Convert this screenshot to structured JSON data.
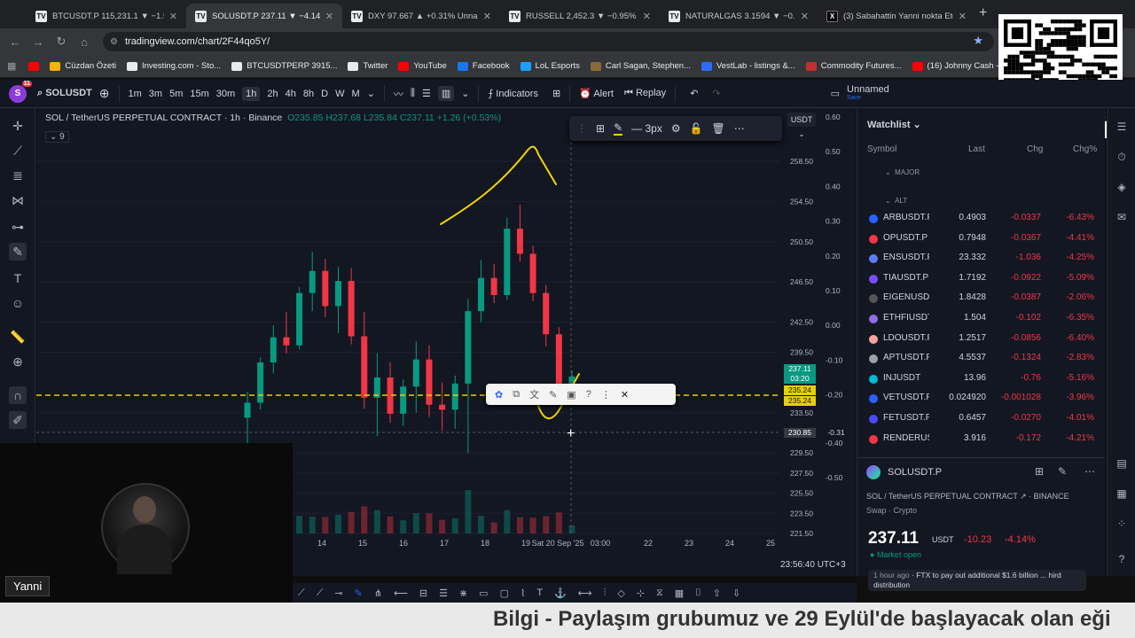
{
  "browser": {
    "tabs": [
      {
        "label": "BTCUSDT.P 115,231.1 ▼ −1.53%",
        "icon": "tradingview-icon",
        "active": false
      },
      {
        "label": "SOLUSDT.P 237.11 ▼ −4.14% U",
        "icon": "tradingview-icon",
        "active": true
      },
      {
        "label": "DXY 97.667 ▲ +0.31% Unname",
        "icon": "tradingview-icon",
        "active": false
      },
      {
        "label": "RUSSELL 2,452.3 ▼ −0.95% Un",
        "icon": "tradingview-icon",
        "active": false
      },
      {
        "label": "NATURALGAS 3.1594 ▼ −0.77%",
        "icon": "tradingview-icon",
        "active": false
      },
      {
        "label": "(3) Sabahattin Yanni nokta Etek",
        "icon": "x-icon",
        "active": false
      }
    ],
    "url": "tradingview.com/chart/2F44qo5Y/",
    "bookmarks": [
      {
        "label": "Cüzdan Özeti",
        "color": "#f5b400"
      },
      {
        "label": "Investing.com - Sto...",
        "color": "#e8eaed"
      },
      {
        "label": "BTCUSDTPERP 3915...",
        "color": "#e8eaed"
      },
      {
        "label": "Twitter",
        "color": "#e8eaed"
      },
      {
        "label": "YouTube",
        "color": "#ff0000"
      },
      {
        "label": "Facebook",
        "color": "#1877f2"
      },
      {
        "label": "LoL Esports",
        "color": "#1aa0ff"
      },
      {
        "label": "Carl Sagan, Stephen...",
        "color": "#8a6a3a"
      },
      {
        "label": "VestLab - listings &...",
        "color": "#2d6bff"
      },
      {
        "label": "Commodity Futures...",
        "color": "#c03030"
      },
      {
        "label": "(16) Johnny Cash -...",
        "color": "#ff0000"
      }
    ]
  },
  "toolbar": {
    "avatar_letter": "S",
    "avatar_badge": "11",
    "symbol": "SOLUSDT",
    "intervals": [
      "1m",
      "3m",
      "5m",
      "15m",
      "30m",
      "1h",
      "2h",
      "4h",
      "8h",
      "D",
      "W",
      "M"
    ],
    "active_interval": "1h",
    "indicators_label": "Indicators",
    "alert_label": "Alert",
    "replay_label": "Replay",
    "layout_name": "Unnamed",
    "layout_sub": "Save"
  },
  "legend": {
    "title": "SOL / TetherUS PERPETUAL CONTRACT · 1h · Binance",
    "open": "O235.85",
    "high": "H237.68",
    "low": "L235.84",
    "close": "C237.11",
    "change": "+1.26 (+0.53%)",
    "indicator_count": "9"
  },
  "drawing_toolbar": {
    "width_label": "3px"
  },
  "currency_button": "USDT",
  "chart_data": {
    "type": "candlestick",
    "price_axis": {
      "ticks": [
        "258.50",
        "254.50",
        "250.50",
        "246.50",
        "242.50",
        "239.50",
        "233.50",
        "229.50",
        "227.50",
        "225.50",
        "223.50",
        "221.50"
      ]
    },
    "oscillator_axis": {
      "ticks": [
        "0.60",
        "0.50",
        "0.40",
        "0.30",
        "0.20",
        "0.10",
        "0.00",
        "-0.10",
        "-0.20",
        "-0.40",
        "-0.50"
      ]
    },
    "price_labels": [
      {
        "value": "237.11",
        "sub": "03:20",
        "bg": "#089981"
      },
      {
        "value": "235.24",
        "sub": "",
        "bg": "#e8d000"
      },
      {
        "value": "235.24",
        "sub": "",
        "bg": "#e8d000"
      },
      {
        "value": "230.85",
        "sub": "",
        "bg": "#363a45"
      },
      {
        "value": "-0.31",
        "sub": "",
        "bg": "#131722"
      }
    ],
    "time_axis": [
      "14",
      "15",
      "16",
      "17",
      "18",
      "19",
      "Sat 20 Sep '25",
      "03:00",
      "22",
      "23",
      "24",
      "25"
    ],
    "clock": "23:56:40 UTC+3",
    "candles": [
      {
        "o": 233.0,
        "h": 235.6,
        "l": 229.9,
        "c": 234.5
      },
      {
        "o": 234.5,
        "h": 239.0,
        "l": 233.8,
        "c": 238.5
      },
      {
        "o": 238.5,
        "h": 242.2,
        "l": 237.4,
        "c": 241.0
      },
      {
        "o": 241.0,
        "h": 243.5,
        "l": 239.4,
        "c": 240.2
      },
      {
        "o": 240.2,
        "h": 246.0,
        "l": 239.8,
        "c": 245.4
      },
      {
        "o": 245.4,
        "h": 249.5,
        "l": 243.6,
        "c": 247.6
      },
      {
        "o": 247.6,
        "h": 248.8,
        "l": 243.0,
        "c": 244.1
      },
      {
        "o": 244.1,
        "h": 248.0,
        "l": 241.4,
        "c": 246.6
      },
      {
        "o": 246.6,
        "h": 247.9,
        "l": 240.3,
        "c": 241.1
      },
      {
        "o": 241.1,
        "h": 243.5,
        "l": 233.9,
        "c": 235.0
      },
      {
        "o": 235.0,
        "h": 239.4,
        "l": 231.2,
        "c": 237.0
      },
      {
        "o": 237.0,
        "h": 238.5,
        "l": 232.5,
        "c": 233.4
      },
      {
        "o": 233.4,
        "h": 236.8,
        "l": 232.2,
        "c": 236.1
      },
      {
        "o": 236.1,
        "h": 240.6,
        "l": 233.5,
        "c": 238.8
      },
      {
        "o": 238.8,
        "h": 240.2,
        "l": 233.1,
        "c": 234.3
      },
      {
        "o": 234.3,
        "h": 236.5,
        "l": 231.7,
        "c": 233.8
      },
      {
        "o": 233.8,
        "h": 237.2,
        "l": 231.9,
        "c": 236.4
      },
      {
        "o": 236.4,
        "h": 244.8,
        "l": 229.5,
        "c": 243.6
      },
      {
        "o": 243.6,
        "h": 248.7,
        "l": 242.5,
        "c": 246.9
      },
      {
        "o": 246.9,
        "h": 248.3,
        "l": 244.4,
        "c": 245.2
      },
      {
        "o": 245.2,
        "h": 252.9,
        "l": 244.7,
        "c": 251.8
      },
      {
        "o": 251.8,
        "h": 254.2,
        "l": 248.5,
        "c": 249.3
      },
      {
        "o": 249.3,
        "h": 250.1,
        "l": 244.6,
        "c": 245.4
      },
      {
        "o": 245.4,
        "h": 246.2,
        "l": 240.1,
        "c": 241.3
      },
      {
        "o": 241.3,
        "h": 242.0,
        "l": 234.6,
        "c": 235.9
      },
      {
        "o": 235.9,
        "h": 237.7,
        "l": 234.9,
        "c": 237.1
      }
    ]
  },
  "watchlist": {
    "title": "Watchlist",
    "columns": [
      "Symbol",
      "Last",
      "Chg",
      "Chg%"
    ],
    "sections": [
      "MAJOR",
      "ALT"
    ],
    "rows": [
      {
        "symbol": "ARBUSDT.P",
        "last": "0.4903",
        "chg": "-0.0337",
        "chgp": "-6.43%",
        "color": "#2962ff"
      },
      {
        "symbol": "OPUSDT.P",
        "last": "0.7948",
        "chg": "-0.0367",
        "chgp": "-4.41%",
        "color": "#f23645"
      },
      {
        "symbol": "ENSUSDT.P",
        "last": "23.332",
        "chg": "-1.036",
        "chgp": "-4.25%",
        "color": "#5c7cfa"
      },
      {
        "symbol": "TIAUSDT.P",
        "last": "1.7192",
        "chg": "-0.0922",
        "chgp": "-5.09%",
        "color": "#7c4dff"
      },
      {
        "symbol": "EIGENUSDT.P",
        "last": "1.8428",
        "chg": "-0.0387",
        "chgp": "-2.06%",
        "color": "#555"
      },
      {
        "symbol": "ETHFIUSDT.P",
        "last": "1.504",
        "chg": "-0.102",
        "chgp": "-6.35%",
        "color": "#8d6ee8"
      },
      {
        "symbol": "LDOUSDT.P",
        "last": "1.2517",
        "chg": "-0.0856",
        "chgp": "-6.40%",
        "color": "#f5a3a3"
      },
      {
        "symbol": "APTUSDT.P",
        "last": "4.5537",
        "chg": "-0.1324",
        "chgp": "-2.83%",
        "color": "#9aa0a6"
      },
      {
        "symbol": "INJUSDT",
        "last": "13.96",
        "chg": "-0.76",
        "chgp": "-5.16%",
        "color": "#00bcd4"
      },
      {
        "symbol": "VETUSDT.P",
        "last": "0.024920",
        "chg": "-0.001028",
        "chgp": "-3.96%",
        "color": "#2962ff"
      },
      {
        "symbol": "FETUSDT.P",
        "last": "0.6457",
        "chg": "-0.0270",
        "chgp": "-4.01%",
        "color": "#4a4aff"
      },
      {
        "symbol": "RENDERUS",
        "last": "3.916",
        "chg": "-0.172",
        "chgp": "-4.21%",
        "color": "#f23645"
      }
    ]
  },
  "details": {
    "symbol": "SOLUSDT.P",
    "name": "SOL / TetherUS PERPETUAL CONTRACT",
    "exchange": "BINANCE",
    "category": "Swap · Crypto",
    "price": "237.11",
    "currency": "USDT",
    "change": "-10.23",
    "change_pct": "-4.14%",
    "market_status": "Market open",
    "news_time": "1 hour ago",
    "news_text": "FTX to pay out additional $1.6 billion ... hird distribution"
  },
  "stream": {
    "name_tag": "Yanni",
    "ticker": "Bilgi - Paylaşım grubumuz ve 29 Eylül'de başlayacak olan eği"
  }
}
